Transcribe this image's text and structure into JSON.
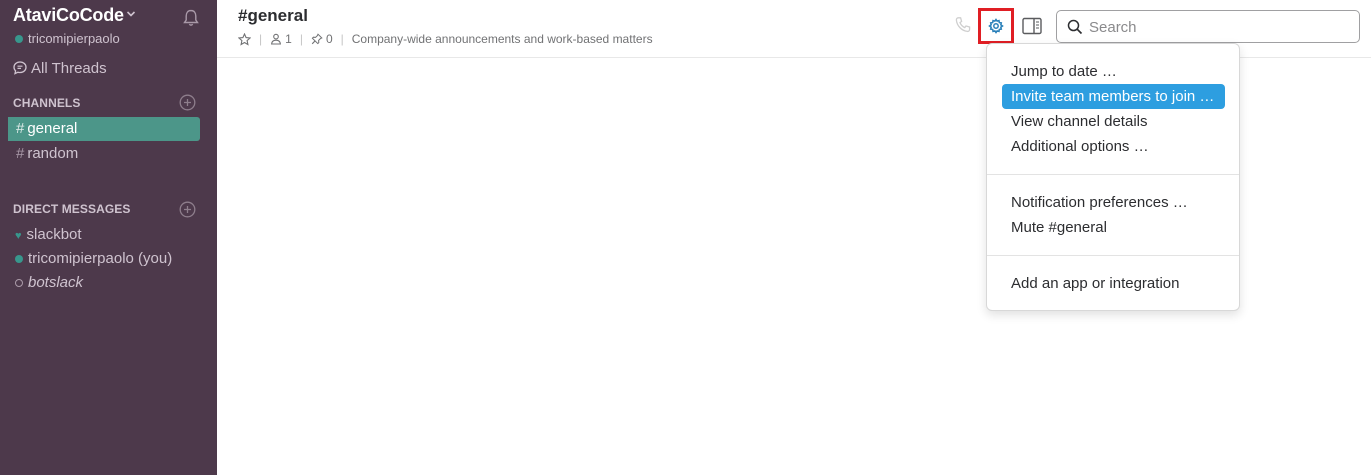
{
  "sidebar": {
    "team_name": "AtaviCoCode",
    "user_name": "tricomipierpaolo",
    "all_threads": "All Threads",
    "channels_title": "CHANNELS",
    "channels": [
      {
        "name": "general",
        "active": true
      },
      {
        "name": "random",
        "active": false
      }
    ],
    "dm_title": "DIRECT MESSAGES",
    "direct_messages": [
      {
        "name": "slackbot"
      },
      {
        "name": "tricomipierpaolo (you)"
      },
      {
        "name": "botslack"
      }
    ]
  },
  "header": {
    "channel_title": "#general",
    "members_count": "1",
    "pinned_count": "0",
    "description": "Company-wide announcements and work-based matters",
    "search_placeholder": "Search"
  },
  "menu": {
    "items": [
      "Jump to date …",
      "Invite team members to join …",
      "View channel details",
      "Additional options …",
      "Notification preferences …",
      "Mute #general",
      "Add an app or integration"
    ],
    "highlighted_index": 1
  },
  "colors": {
    "sidebar_bg": "#4d394b",
    "active_channel": "#4c9689",
    "menu_highlight": "#2d9ee0",
    "presence_online": "#38978d",
    "gear_highlight_border": "#e01e24"
  }
}
